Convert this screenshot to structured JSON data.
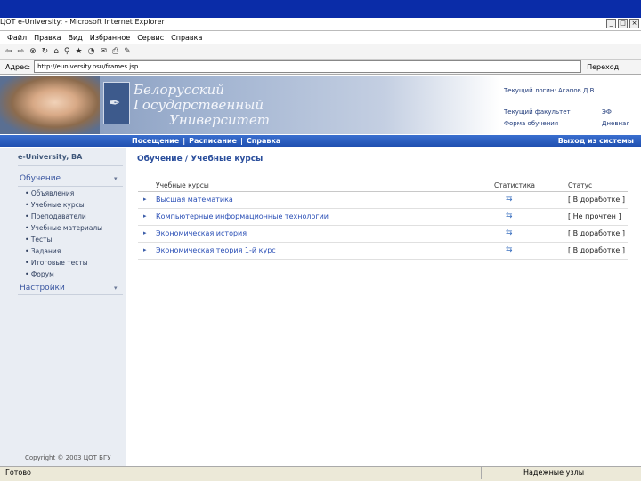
{
  "window": {
    "title": "ЦОТ e-University: - Microsoft Internet Explorer",
    "controls": [
      "_",
      "□",
      "×"
    ]
  },
  "menu": [
    "Файл",
    "Правка",
    "Вид",
    "Избранное",
    "Сервис",
    "Справка"
  ],
  "toolbar_icons": [
    "back-icon",
    "forward-icon",
    "stop-icon",
    "refresh-icon",
    "home-icon",
    "search-icon",
    "favorites-icon",
    "history-icon",
    "mail-icon",
    "print-icon",
    "edit-icon"
  ],
  "address": {
    "label": "Адрес:",
    "url": "http://euniversity.bsu/frames.jsp",
    "go": "Переход"
  },
  "header": {
    "university_lines": [
      "Белорусский",
      "Государственный",
      "Университет"
    ],
    "user": "Текущий логин: Агапов Д.В.",
    "faculty_label": "Текущий факультет",
    "faculty_value": "ЭФ",
    "study_label": "Форма обучения",
    "study_value": "Дневная"
  },
  "nav": {
    "items": [
      "Посещение",
      "Расписание",
      "Справка"
    ],
    "separator": "|",
    "logout": "Выход из системы"
  },
  "sidebar": {
    "logo": "e-University, BA",
    "section1": "Обучение",
    "items": [
      "Объявления",
      "Учебные курсы",
      "Преподаватели",
      "Учебные материалы",
      "Тесты",
      "Задания",
      "Итоговые тесты",
      "Форум"
    ],
    "section2": "Настройки",
    "collapse_symbol": "▾",
    "item_bullet": "•",
    "copyright": "Copyright © 2003 ЦОТ БГУ"
  },
  "main": {
    "breadcrumb": "Обучение / Учебные курсы",
    "columns": [
      "Учебные курсы",
      "Статистика",
      "Статус"
    ],
    "rows": [
      {
        "name": "Высшая математика",
        "status": "[ В доработке ]"
      },
      {
        "name": "Компьютерные информационные технологии",
        "status": "[ Не прочтен ]"
      },
      {
        "name": "Экономическая история",
        "status": "[ В доработке ]"
      },
      {
        "name": "Экономическая теория 1-й курс",
        "status": "[ В доработке ]"
      }
    ],
    "row_arrow": "▸",
    "stat_icon": "⇆"
  },
  "status": {
    "left": "Готово",
    "right": "Надежные узлы"
  }
}
